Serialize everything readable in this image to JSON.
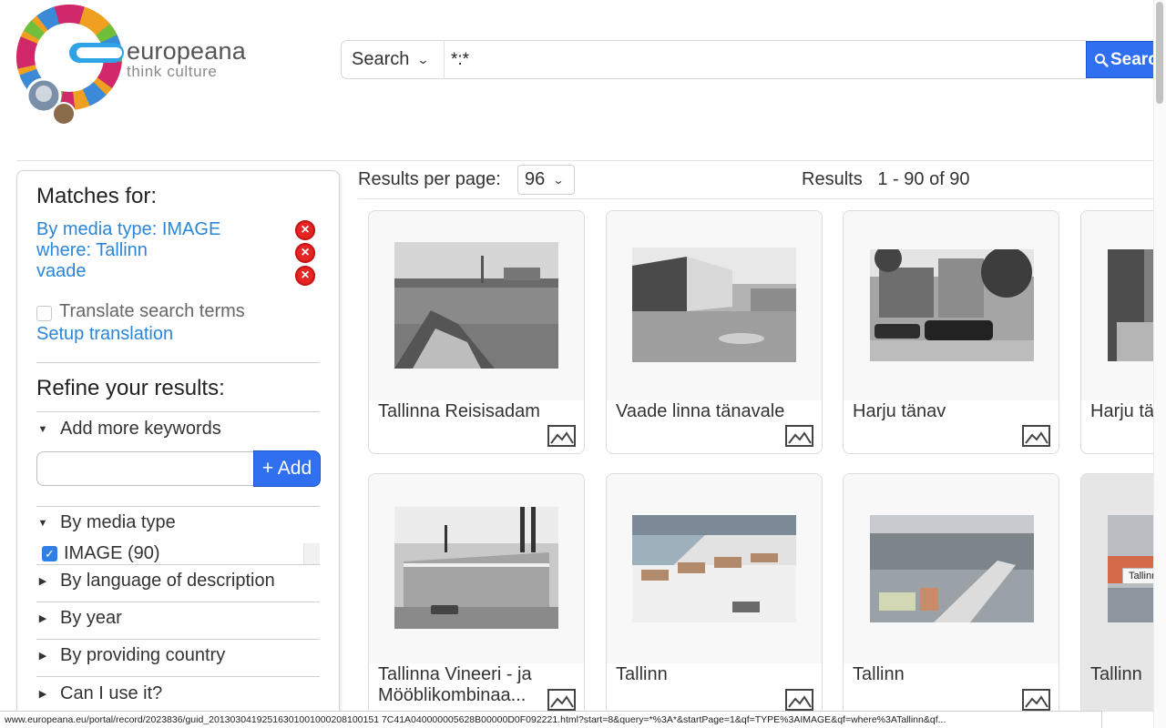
{
  "header": {
    "logo_word": "europeana",
    "logo_tagline": "think culture",
    "search_type": "Search",
    "search_value": "*:*",
    "search_button": "Search",
    "search_button_visible": "Searc"
  },
  "sidebar": {
    "matches_title": "Matches for:",
    "matches": [
      "By media type: IMAGE",
      "where: Tallinn",
      "vaade"
    ],
    "translate_label": "Translate search terms",
    "setup_translation": "Setup translation",
    "refine_title": "Refine your results:",
    "keywords_facet": "Add more keywords",
    "add_button": "+ Add",
    "media_facet": "By media type",
    "media_option": "IMAGE (90)",
    "facets": [
      "By language of description",
      "By year",
      "By providing country",
      "Can I use it?"
    ]
  },
  "results": {
    "per_page_label": "Results per page:",
    "per_page_value": "96",
    "count_label": "Results",
    "count_range": "1 - 90 of 90",
    "items": [
      {
        "title": "Tallinna Reisisadam"
      },
      {
        "title": "Vaade linna tänavale"
      },
      {
        "title": "Harju tänav"
      },
      {
        "title": "Harju tänav"
      },
      {
        "title": "Tallinna Vineeri - ja Mööblikombinaa..."
      },
      {
        "title": "Tallinn"
      },
      {
        "title": "Tallinn"
      },
      {
        "title": "Tallinn"
      }
    ],
    "tooltip": "Tallinn"
  },
  "status_url": "www.europeana.eu/portal/record/2023836/guid_20130304192516301001000208100151 7C41A040000005628B00000D0F092221.html?start=8&query=*%3A*&startPage=1&qf=TYPE%3AIMAGE&qf=where%3ATallinn&qf...",
  "colors": {
    "link": "#2a86d9",
    "button": "#2f6ff0",
    "remove": "#e52424"
  }
}
